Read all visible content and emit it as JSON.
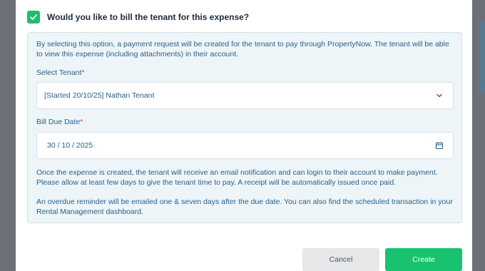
{
  "dialog": {
    "question": "Would you like to bill the tenant for this expense?",
    "checked": true,
    "intro": "By selecting this option, a payment request will be created for the tenant to pay through PropertyNow. The tenant will be able to view this expense (including attachments) in their account.",
    "tenant_label": "Select Tenant",
    "tenant_value": "[Started 20/10/25] Nathan Tenant",
    "due_label": "Bill Due Date",
    "due_value": "30 / 10 / 2025",
    "required_mark": "*",
    "notice1": "Once the expense is created, the tenant will receive an email notification and can login to their account to make payment. Please allow at least few days to give the tenant time to pay. A receipt will be automatically issued once paid.",
    "notice2": "An overdue reminder will be emailed one & seven days after the due date. You can also find the scheduled transaction in your Rental Management dashboard.",
    "cancel_label": "Cancel",
    "create_label": "Create"
  },
  "colors": {
    "accent": "#1fbd6d",
    "panel_text": "#2a5f85",
    "required": "#e0364c"
  },
  "icons": {
    "checkbox": "check-icon",
    "dropdown": "chevron-down-icon",
    "date": "calendar-icon"
  }
}
